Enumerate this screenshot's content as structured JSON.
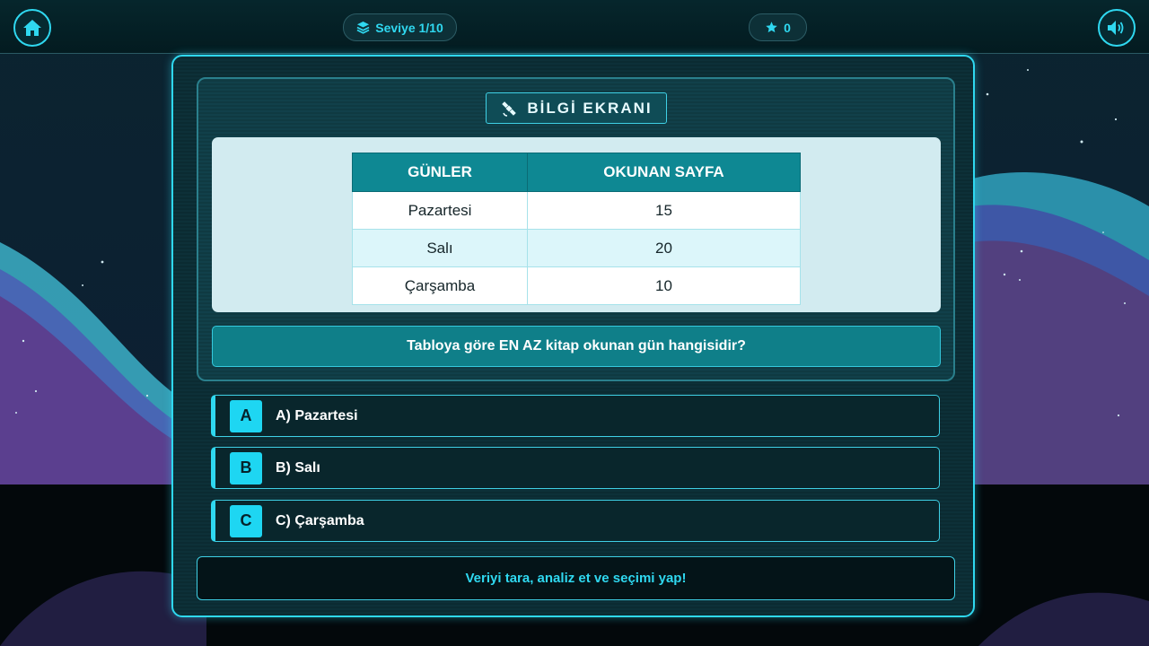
{
  "header": {
    "level_label": "Seviye 1/10",
    "score": "0",
    "home_icon": "home-icon",
    "layers_icon": "layers-icon",
    "star_icon": "star-icon",
    "sound_icon": "speaker-icon"
  },
  "info": {
    "title": "BİLGİ EKRANI",
    "title_icon": "satellite-icon",
    "table": {
      "headers": [
        "GÜNLER",
        "OKUNAN SAYFA"
      ],
      "rows": [
        [
          "Pazartesi",
          "15"
        ],
        [
          "Salı",
          "20"
        ],
        [
          "Çarşamba",
          "10"
        ]
      ]
    },
    "question": "Tabloya göre EN AZ kitap okunan gün hangisidir?"
  },
  "options": [
    {
      "letter": "A",
      "text": "A) Pazartesi"
    },
    {
      "letter": "B",
      "text": "B) Salı"
    },
    {
      "letter": "C",
      "text": "C) Çarşamba"
    }
  ],
  "hint": "Veriyi tara, analiz et ve seçimi yap!",
  "colors": {
    "accent": "#2fd8f0",
    "panel": "#0b2b32",
    "table_header": "#0e8893",
    "question_bar": "#0f7f89"
  }
}
